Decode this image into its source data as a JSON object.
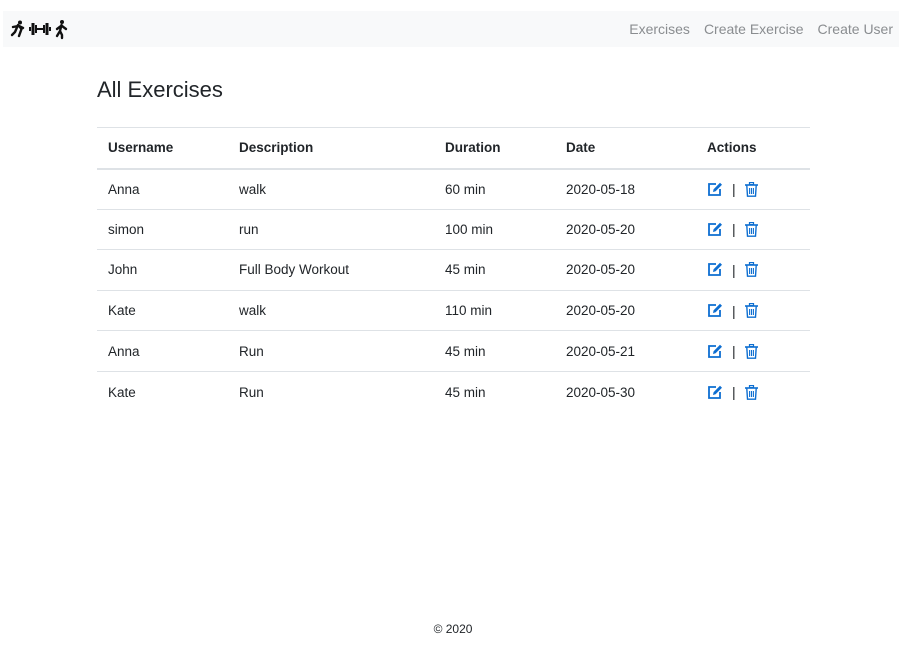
{
  "navbar": {
    "brand_icons": [
      "running-person-icon",
      "dumbbell-icon",
      "walking-person-icon"
    ],
    "links": [
      {
        "label": "Exercises"
      },
      {
        "label": "Create Exercise"
      },
      {
        "label": "Create User"
      }
    ]
  },
  "main": {
    "title": "All Exercises",
    "table": {
      "headers": [
        "Username",
        "Description",
        "Duration",
        "Date",
        "Actions"
      ],
      "rows": [
        {
          "username": "Anna",
          "description": "walk",
          "duration": "60 min",
          "date": "2020-05-18"
        },
        {
          "username": "simon",
          "description": "run",
          "duration": "100 min",
          "date": "2020-05-20"
        },
        {
          "username": "John",
          "description": "Full Body Workout",
          "duration": "45 min",
          "date": "2020-05-20"
        },
        {
          "username": "Kate",
          "description": "walk",
          "duration": "110 min",
          "date": "2020-05-20"
        },
        {
          "username": "Anna",
          "description": "Run",
          "duration": "45 min",
          "date": "2020-05-21"
        },
        {
          "username": "Kate",
          "description": "Run",
          "duration": "45 min",
          "date": "2020-05-30"
        }
      ],
      "action_separator": "|",
      "action_icons": [
        "edit-icon",
        "trash-icon"
      ]
    }
  },
  "footer": {
    "text": "© 2020"
  },
  "colors": {
    "icon_blue": "#0d6ed1",
    "navbar_bg": "#f8f9fa",
    "nav_link": "#8a8d90"
  }
}
